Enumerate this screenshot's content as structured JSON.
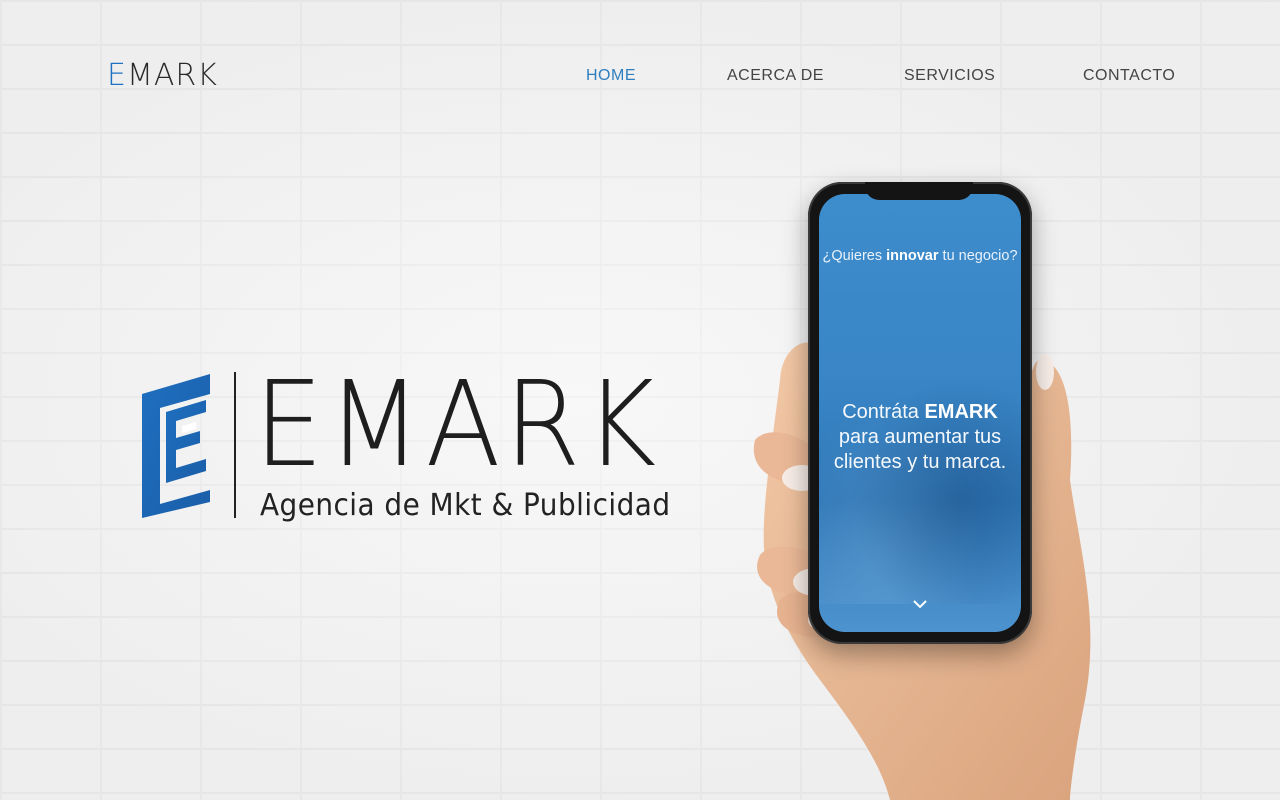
{
  "header": {
    "brand_first": "E",
    "brand_rest": "MARK",
    "nav": [
      {
        "label": "HOME",
        "active": true
      },
      {
        "label": "ACERCA DE",
        "active": false
      },
      {
        "label": "SERVICIOS",
        "active": false
      },
      {
        "label": "CONTACTO",
        "active": false
      }
    ]
  },
  "hero": {
    "logo_word": "EMARK",
    "tagline": "Agencia de Mkt & Publicidad"
  },
  "phone": {
    "question_pre": "¿Quieres ",
    "question_bold": "innovar",
    "question_post": " tu negocio?",
    "msg_pre": "Contráta ",
    "msg_bold": "EMARK",
    "msg_line2": "para aumentar tus",
    "msg_line3": "clientes y tu marca."
  },
  "colors": {
    "accent": "#1f72c2",
    "nav_active": "#2f7fbf",
    "screen": "#3a86c6"
  },
  "icons": [
    "logo-e-mark-icon",
    "chevron-down-icon"
  ]
}
